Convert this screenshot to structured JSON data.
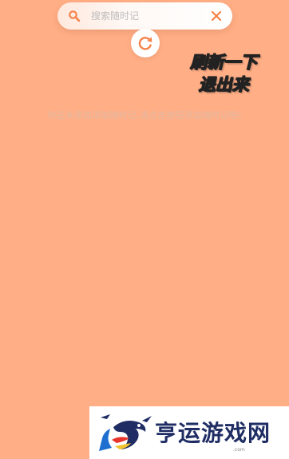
{
  "search": {
    "placeholder": "搜索随时记",
    "value": ""
  },
  "annotation": {
    "line1": "刷新一下",
    "line2": "退出来"
  },
  "empty_state": {
    "message": "你还未添加添加随时记,请点击按钮添加随时记吧!"
  },
  "watermark": {
    "brand": "亨运游戏网",
    "domain": ".com"
  },
  "colors": {
    "background": "#FFAE86",
    "accent": "#F5824A",
    "empty_text": "#E2B8A0",
    "annotation_fill": "#FFF3A0"
  },
  "icons": {
    "search": "search-icon",
    "clear": "close-icon",
    "refresh": "refresh-icon"
  }
}
